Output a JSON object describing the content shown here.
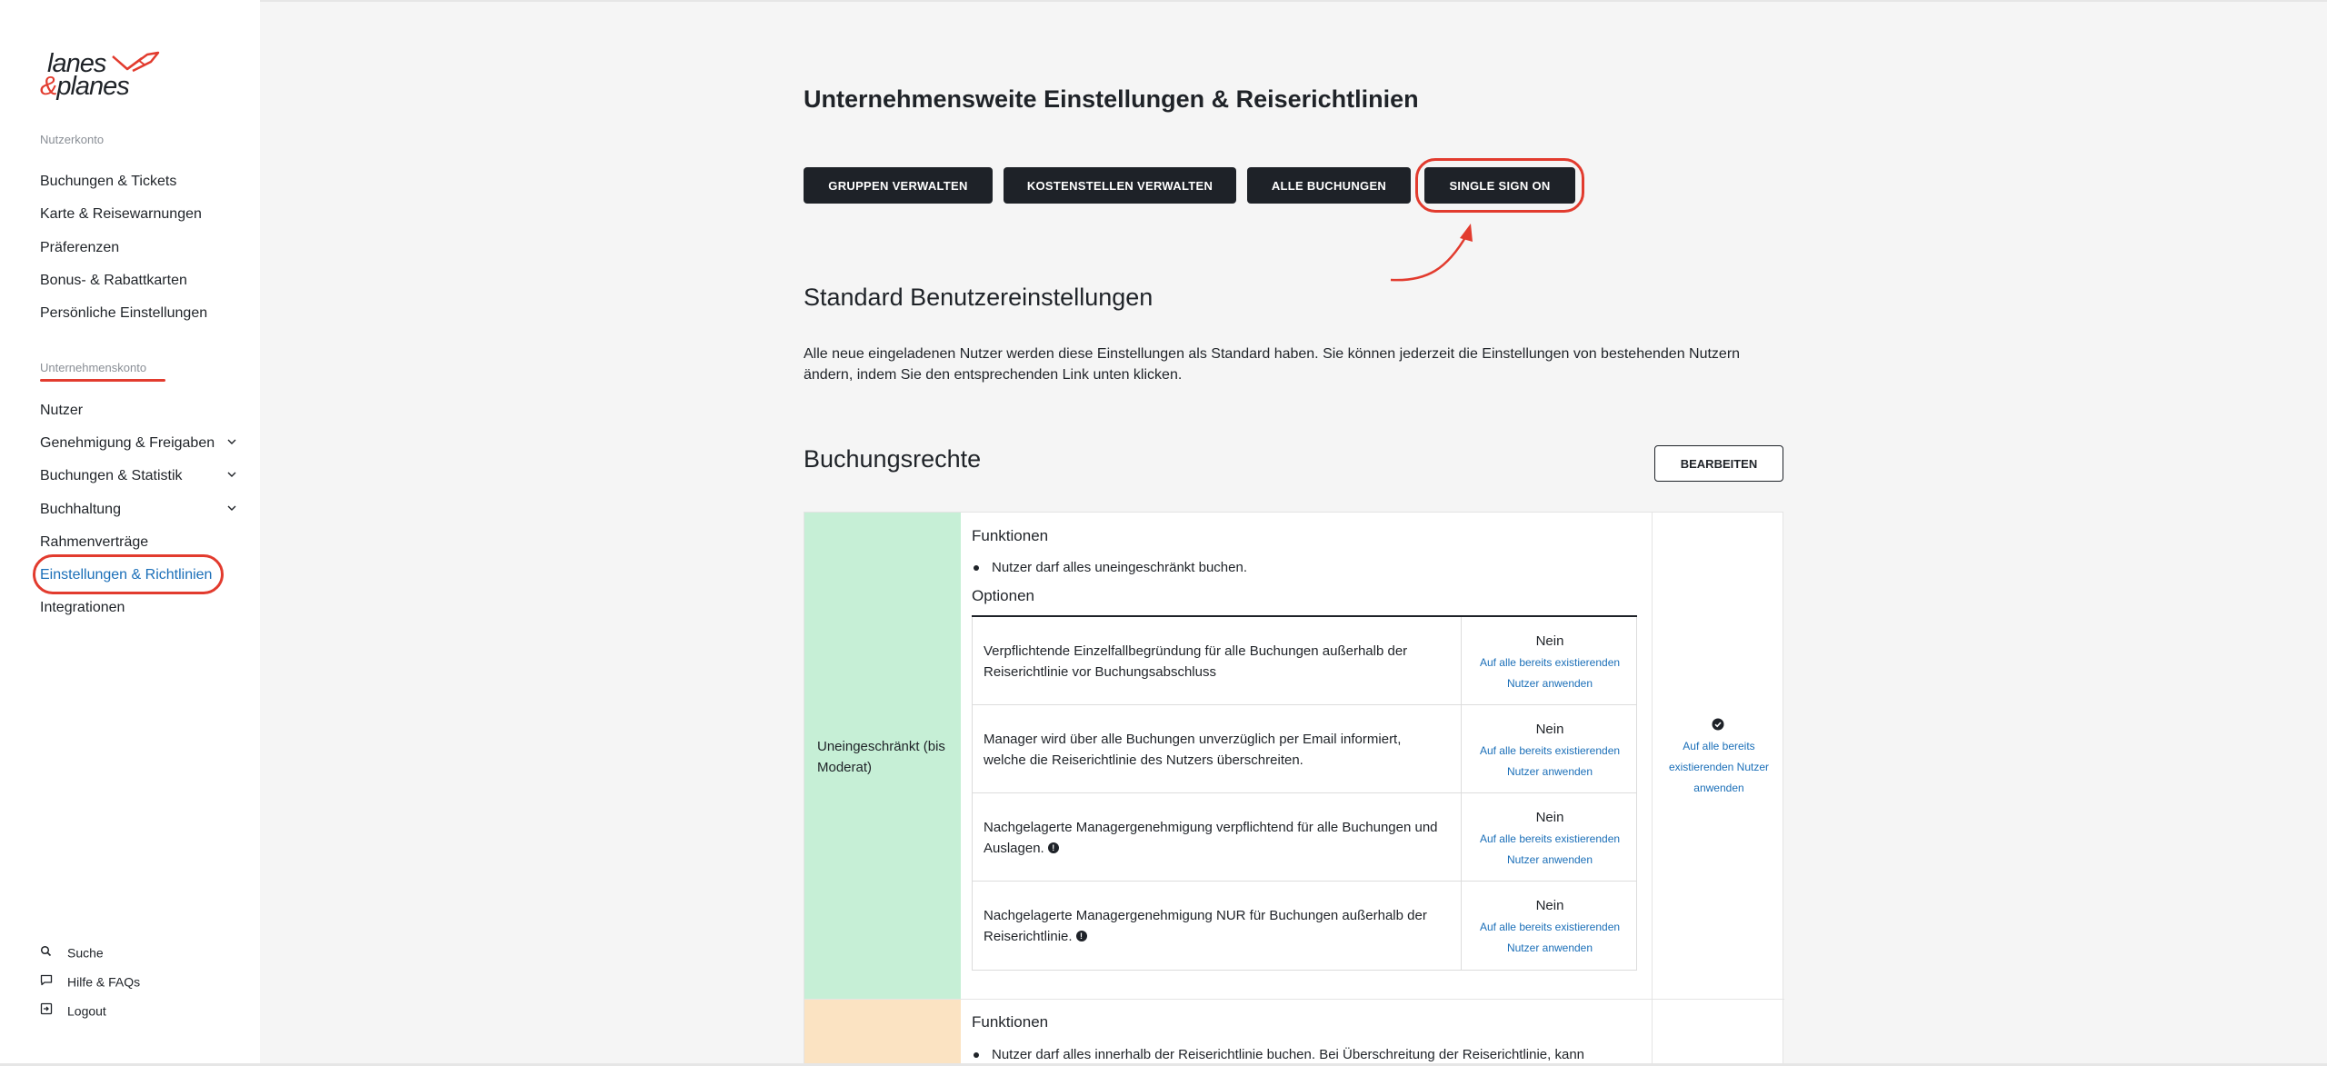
{
  "brand": {
    "line1": "lanes",
    "amp": "&",
    "line2": "planes"
  },
  "sidebar": {
    "section_user": "Nutzerkonto",
    "user_items": [
      {
        "label": "Buchungen & Tickets"
      },
      {
        "label": "Karte & Reisewarnungen"
      },
      {
        "label": "Präferenzen"
      },
      {
        "label": "Bonus- & Rabattkarten"
      },
      {
        "label": "Persönliche Einstellungen"
      }
    ],
    "section_company": "Unternehmenskonto",
    "company_items": [
      {
        "label": "Nutzer"
      },
      {
        "label": "Genehmigung & Freigaben"
      },
      {
        "label": "Buchungen & Statistik"
      },
      {
        "label": "Buchhaltung"
      },
      {
        "label": "Rahmenverträge"
      },
      {
        "label": "Einstellungen & Richtlinien"
      },
      {
        "label": "Integrationen"
      }
    ],
    "footer": [
      {
        "label": "Suche",
        "icon": "search-icon"
      },
      {
        "label": "Hilfe & FAQs",
        "icon": "chat-icon"
      },
      {
        "label": "Logout",
        "icon": "logout-icon"
      }
    ]
  },
  "main": {
    "title": "Unternehmensweite Einstellungen & Reiserichtlinien",
    "buttons": {
      "groups": "GRUPPEN VERWALTEN",
      "cost_centers": "KOSTENSTELLEN VERWALTEN",
      "all_bookings": "ALLE BUCHUNGEN",
      "sso": "SINGLE SIGN ON"
    },
    "defaults_title": "Standard Benutzereinstellungen",
    "defaults_text": "Alle neue eingeladenen Nutzer werden diese Einstellungen als Standard haben. Sie können jederzeit die Einstellungen von bestehenden Nutzern ändern, indem Sie den entsprechenden Link unten klicken.",
    "rights_title": "Buchungsrechte",
    "edit_label": "BEARBEITEN",
    "level1": {
      "name": "Uneingeschränkt (bis Moderat)",
      "functions_title": "Funktionen",
      "function_text": "Nutzer darf alles uneingeschränkt buchen.",
      "options_title": "Optionen",
      "options": [
        {
          "desc": "Verpflichtende Einzelfallbegründung für alle Buchungen außerhalb der Reiserichtlinie vor Buchungsabschluss",
          "value": "Nein",
          "apply": "Auf alle bereits existierenden Nutzer anwenden"
        },
        {
          "desc": "Manager wird über alle Buchungen unverzüglich per Email informiert, welche die Reiserichtlinie des Nutzers überschreiten.",
          "value": "Nein",
          "apply": "Auf alle bereits existierenden Nutzer anwenden"
        },
        {
          "desc": "Nachgelagerte Managergenehmigung verpflichtend für alle Buchungen und Auslagen.",
          "value": "Nein",
          "apply": "Auf alle bereits existierenden Nutzer anwenden"
        },
        {
          "desc": "Nachgelagerte Managergenehmigung NUR für Buchungen außerhalb der Reiserichtlinie.",
          "value": "Nein",
          "apply": "Auf alle bereits existierenden Nutzer anwenden"
        }
      ],
      "apply_all": "Auf alle bereits existierenden Nutzer anwenden"
    },
    "level2": {
      "functions_title": "Funktionen",
      "function_text": "Nutzer darf alles innerhalb der Reiserichtlinie buchen. Bei Überschreitung der Reiserichtlinie, kann"
    }
  },
  "colors": {
    "accent": "#e23b2e",
    "link": "#1b6fb8",
    "dark_button": "#1e2228",
    "green": "#c6efd6",
    "peach": "#fbe3c2"
  }
}
